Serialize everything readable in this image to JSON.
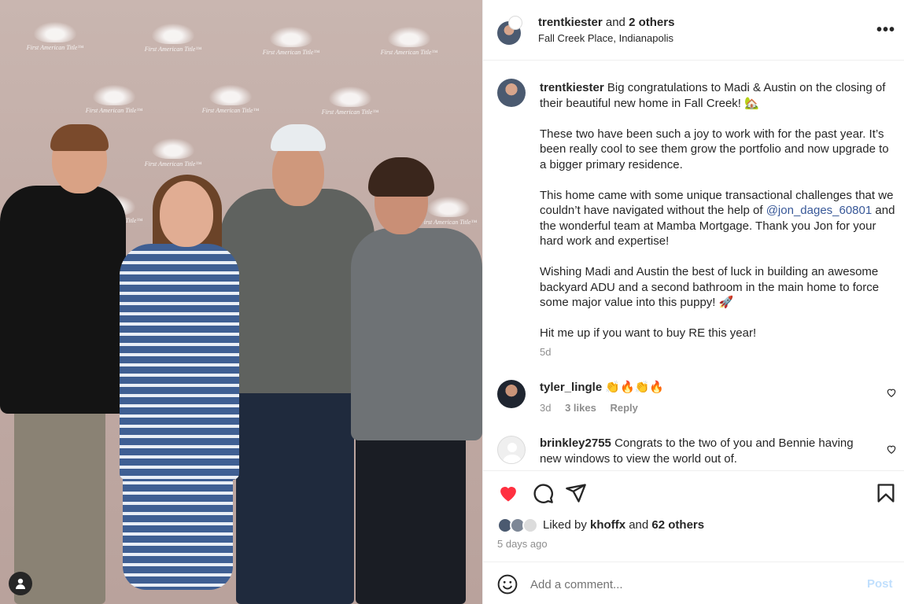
{
  "photo": {
    "backdrop_tagline": "First American Title™",
    "description_icon": "user-tag-icon"
  },
  "header": {
    "username": "trentkiester",
    "coauthors": "and",
    "coauthors_count": "2 others",
    "location": "Fall Creek Place, Indianapolis",
    "more_icon": "more-options-icon",
    "more_label": "•••"
  },
  "caption": {
    "username": "trentkiester",
    "paragraph_1": "Big congratulations to Madi & Austin on the closing of their beautiful new home in Fall Creek! 🏡",
    "paragraph_2": "These two have been such a joy to work with for the past year. It’s been really cool to see them grow the portfolio and now upgrade to a bigger primary residence.",
    "paragraph_3_before": "This home came with some unique transactional challenges that we couldn’t have navigated without the help of ",
    "mention": "@jon_dages_60801",
    "paragraph_3_after": " and the wonderful team at Mamba Mortgage. Thank you Jon for your hard work and expertise!",
    "paragraph_4": "Wishing Madi and Austin the best of luck in building an awesome backyard ADU and a second bathroom in the main home to force some major value into this puppy! 🚀",
    "paragraph_5": "Hit me up if you want to buy RE this year!",
    "time": "5d"
  },
  "comments": [
    {
      "username": "tyler_lingle",
      "text": "👏🔥👏🔥",
      "time": "3d",
      "likes": "3 likes",
      "reply_label": "Reply"
    },
    {
      "username": "brinkley2755",
      "text": "Congrats to the two of you and Bennie having new windows to view the world out of."
    }
  ],
  "actions": {
    "liked_prefix": "Liked by",
    "liked_user": "khoffx",
    "liked_and": "and",
    "liked_others": "62 others",
    "date": "5 days ago",
    "like_color": "#ff3040"
  },
  "comment_box": {
    "placeholder": "Add a comment...",
    "post_label": "Post"
  }
}
